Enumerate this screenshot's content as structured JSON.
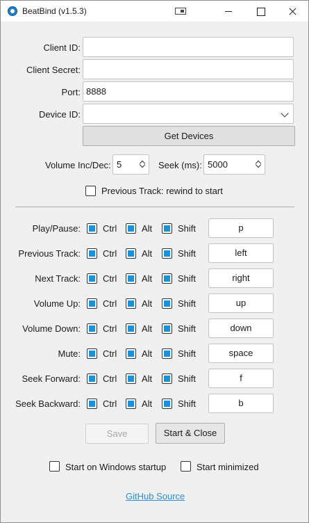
{
  "window": {
    "title": "BeatBind (v1.5.3)"
  },
  "form": {
    "client_id_label": "Client ID:",
    "client_id_value": "",
    "client_secret_label": "Client Secret:",
    "client_secret_value": "",
    "port_label": "Port:",
    "port_value": "8888",
    "device_id_label": "Device ID:",
    "device_id_value": "",
    "get_devices_label": "Get Devices",
    "volume_label": "Volume Inc/Dec:",
    "volume_value": "5",
    "seek_label": "Seek (ms):",
    "seek_value": "5000",
    "prev_rewind_label": "Previous Track: rewind to start",
    "prev_rewind_checked": false
  },
  "hotkeys": {
    "mod_labels": {
      "ctrl": "Ctrl",
      "alt": "Alt",
      "shift": "Shift"
    },
    "rows": [
      {
        "label": "Play/Pause:",
        "ctrl": true,
        "alt": true,
        "shift": true,
        "key": "p"
      },
      {
        "label": "Previous Track:",
        "ctrl": true,
        "alt": true,
        "shift": true,
        "key": "left"
      },
      {
        "label": "Next Track:",
        "ctrl": true,
        "alt": true,
        "shift": true,
        "key": "right"
      },
      {
        "label": "Volume Up:",
        "ctrl": true,
        "alt": true,
        "shift": true,
        "key": "up"
      },
      {
        "label": "Volume Down:",
        "ctrl": true,
        "alt": true,
        "shift": true,
        "key": "down"
      },
      {
        "label": "Mute:",
        "ctrl": true,
        "alt": true,
        "shift": true,
        "key": "space"
      },
      {
        "label": "Seek Forward:",
        "ctrl": true,
        "alt": true,
        "shift": true,
        "key": "f"
      },
      {
        "label": "Seek Backward:",
        "ctrl": true,
        "alt": true,
        "shift": true,
        "key": "b"
      }
    ]
  },
  "actions": {
    "save_label": "Save",
    "save_enabled": false,
    "start_close_label": "Start & Close"
  },
  "options": {
    "startup_label": "Start on Windows startup",
    "startup_checked": false,
    "minimized_label": "Start minimized",
    "minimized_checked": false
  },
  "footer": {
    "github_label": "GitHub Source"
  },
  "colors": {
    "accent": "#1e90d6",
    "link": "#2d8ed6"
  }
}
